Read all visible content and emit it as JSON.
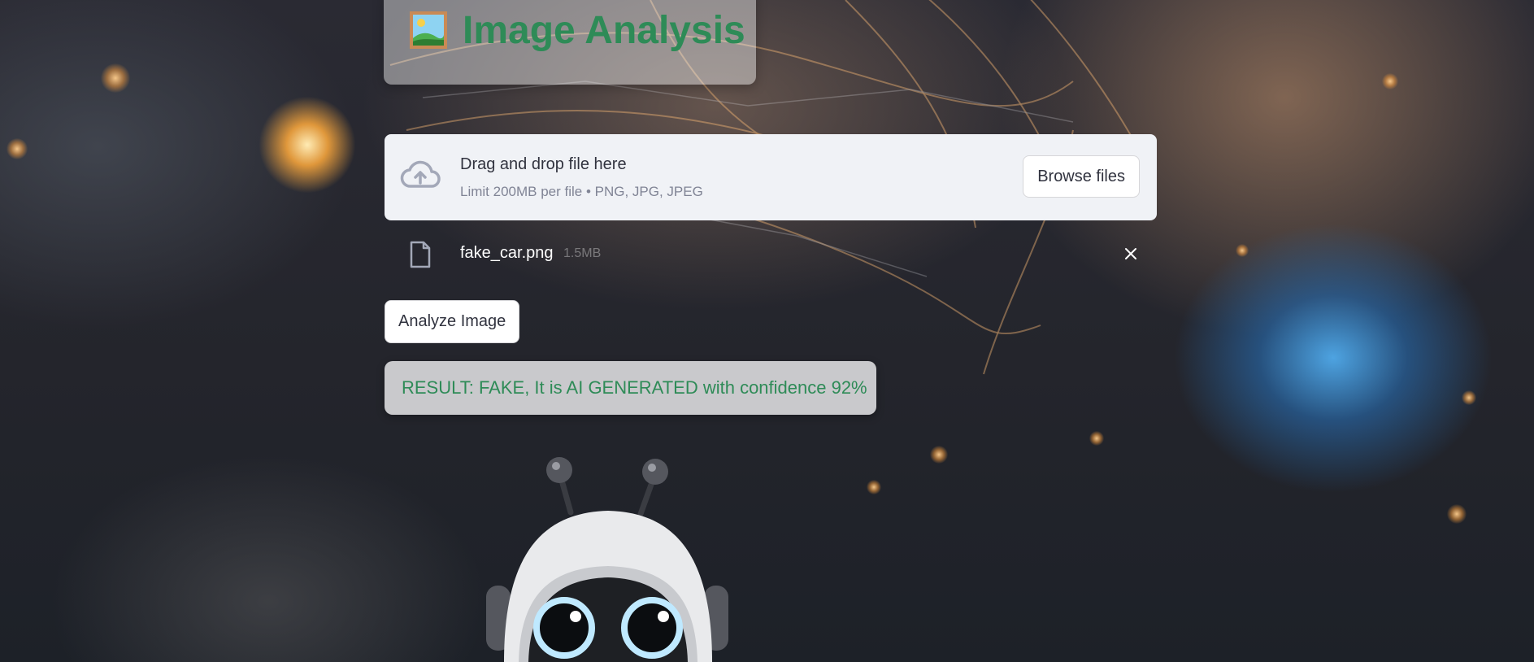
{
  "header": {
    "icon": "framed-picture-icon",
    "title": "Image Analysis"
  },
  "uploader": {
    "icon": "cloud-upload-icon",
    "drop_label": "Drag and drop file here",
    "limit_label": "Limit 200MB per file • PNG, JPG, JPEG",
    "browse_label": "Browse files"
  },
  "uploaded_file": {
    "icon": "file-icon",
    "name": "fake_car.png",
    "size": "1.5MB",
    "remove_icon": "close-icon"
  },
  "actions": {
    "analyze_label": "Analyze Image"
  },
  "result": {
    "text": "RESULT: FAKE, It is AI GENERATED with confidence 92%"
  },
  "colors": {
    "accent_green": "#2e8b57",
    "panel_bg": "#f0f2f6",
    "text_dark": "#31333f",
    "text_muted": "#808495"
  }
}
